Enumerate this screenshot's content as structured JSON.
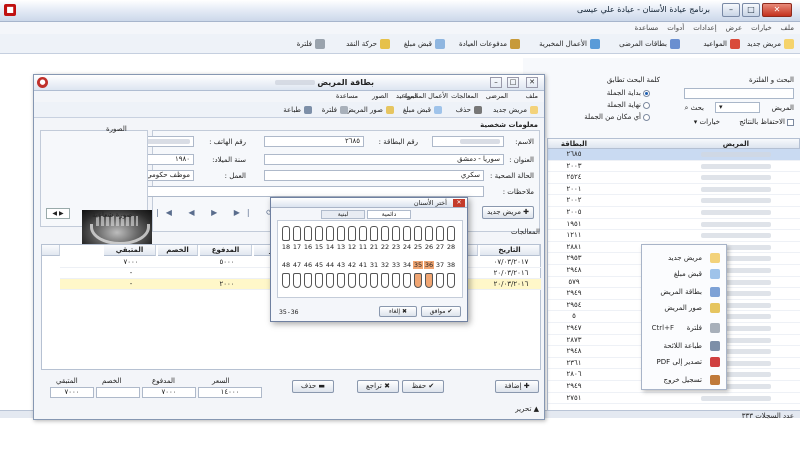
{
  "app": {
    "title": "برنامج عيادة الأسنان - عيادة علي عيسى"
  },
  "menubar": [
    "ملف",
    "خيارات",
    "عرض",
    "إعدادات",
    "أدوات",
    "مساعدة"
  ],
  "toolbar": [
    "مريض جديد",
    "المواعيد",
    "بطاقات المرضى",
    "الأعمال المخبرية",
    "مدفوعات العيادة",
    "قبض مبلغ",
    "حركة النقد",
    "فلترة"
  ],
  "search": {
    "title": "البحث و الفلترة",
    "keyword_title": "كلمة البحث تطابق",
    "options": [
      "بداية الجملة",
      "نهاية الجملة",
      "أي مكان من الجملة"
    ],
    "field_label": "المريض",
    "search_btn": "بحث",
    "keep_results": "الاحتفاظ بالنتائج",
    "options_btn": "خيارات"
  },
  "patients": {
    "headers": [
      "البطاقة",
      "المريض"
    ],
    "cards": [
      "٢٦٨٥",
      "٢٠٠٣",
      "٢٥٢٤",
      "٢٠٠١",
      "٢٠٠٢",
      "٢٠٠٥",
      "١٩٥١",
      "١٢١١",
      "٢٨٨١",
      "٢٩٥٣",
      "٢٩٤٨",
      "٥٧٩",
      "٢٩٤٩",
      "٢٩٥٤",
      "٥",
      "٢٩٤٧",
      "٢٨٧٣",
      "٢٩٤٨",
      "٢٣٦١",
      "٢٨٠٦",
      "٢٩٤٩",
      "٢٧٥١"
    ],
    "footer": "عدد السجلات ٣٣٣"
  },
  "context_menu": [
    {
      "label": "مريض جديد",
      "key": ""
    },
    {
      "label": "قبض مبلغ",
      "key": ""
    },
    {
      "label": "بطاقة المريض",
      "key": ""
    },
    {
      "label": "صور المريض",
      "key": ""
    },
    {
      "label": "فلترة",
      "key": "Ctrl+F"
    },
    {
      "label": "طباعة اللائحة",
      "key": ""
    },
    {
      "label": "تصدير إلى PDF",
      "key": ""
    },
    {
      "label": "تسجيل خروج",
      "key": ""
    }
  ],
  "card": {
    "title": "بطاقة المريض",
    "menu": [
      "ملف",
      "المرضى",
      "المعالجات",
      "الأعمال المخبرية",
      "المواعيد",
      "الصور",
      "مساعدة"
    ],
    "toolbar": [
      "مريض جديد",
      "حذف",
      "قبض مبلغ",
      "صور المريض",
      "فلترة",
      "طباعة"
    ],
    "info_title": "معلومات شخصية",
    "photo_title": "الصورة",
    "fields": {
      "name_label": "الاسم:",
      "card_label": "رقم البطاقة :",
      "card_value": "٢٦٨٥",
      "phone_label": "رقم الهاتف :",
      "address_label": "العنوان :",
      "address_value": "سوريا - دمشق",
      "birth_label": "سنة الميلاد:",
      "birth_value": "١٩٨٠",
      "health_label": "الحالة الصحية :",
      "health_value": "سكري",
      "work_label": "العمل :",
      "work_value": "موظف حكومي",
      "notes_label": "ملاحظات :"
    },
    "add_patient_btn": "مريض جديد",
    "photo_caption": "صورة شعاعية",
    "treatments_label": "المعالجات"
  },
  "treatments": {
    "headers": [
      "التاريخ",
      "الأسنان",
      "السعر",
      "المدفوع",
      "الخصم",
      "المتبقي"
    ],
    "rows": [
      {
        "date": "٠٧/٠٣/٢٠١٧",
        "price": "١٢٠٠٠",
        "paid": "٥٠٠٠",
        "discount": "",
        "remain": "٧٠٠٠"
      },
      {
        "date": "٢٠/٠٣/٢٠١٦",
        "price": "",
        "paid": "",
        "discount": "",
        "remain": "-"
      },
      {
        "date": "٢٠/٠٣/٢٠١٦",
        "price": "٢٠٠٠",
        "paid": "٢٠٠٠",
        "discount": "",
        "remain": "-"
      }
    ],
    "totals_headers": [
      "السعر",
      "المدفوع",
      "الخصم",
      "المتبقي"
    ],
    "totals": [
      "١٤٠٠٠",
      "٧٠٠٠",
      "",
      "٧٠٠٠"
    ],
    "buttons": [
      "إضافة",
      "حفظ",
      "تراجع",
      "حذف"
    ],
    "edit_label": "تحرير"
  },
  "teeth_dialog": {
    "title": "أختر الأسنان",
    "tabs": [
      "دائمية",
      "لبنية"
    ],
    "upper": [
      "18",
      "17",
      "16",
      "15",
      "14",
      "13",
      "12",
      "11",
      "21",
      "22",
      "23",
      "24",
      "25",
      "26",
      "27",
      "28"
    ],
    "lower": [
      "48",
      "47",
      "46",
      "45",
      "44",
      "43",
      "42",
      "41",
      "31",
      "32",
      "33",
      "34",
      "35",
      "36",
      "37",
      "38"
    ],
    "selected": [
      "35",
      "36"
    ],
    "result": "35-36",
    "ok_btn": "موافق",
    "cancel_btn": "إلغاء"
  },
  "colors": {
    "accent": "#1d5fb3",
    "highlight_teeth": "#f0a572",
    "selection_row": "#c9daf2"
  }
}
